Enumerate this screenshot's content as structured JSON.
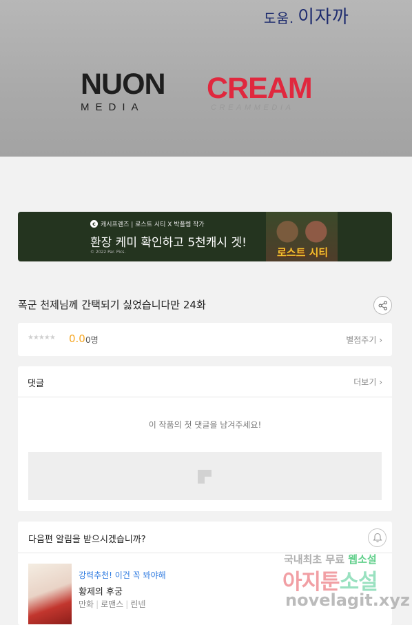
{
  "hero": {
    "credit_prefix": "도움.",
    "credit_name": "이자까",
    "logo_left_mark": "NUON",
    "logo_left_sub": "MEDIA",
    "logo_right_mark": "CREAM",
    "logo_right_sub": "CREAMMEDIA"
  },
  "ad": {
    "brand": "캐시프렌즈 | 로스트 시티 X 박플렘 작가",
    "headline": "환장 케미 확인하고 5천캐시 겟!",
    "copyright": "© 2022 Par. Pics.",
    "logo": "로스트 시티"
  },
  "episode": {
    "title": "폭군 천제님께 간택되기 싫었습니다만 24화"
  },
  "rating": {
    "score": "0.0",
    "count": "0명",
    "rate_link": "별점주기 ›",
    "stars_filled": 0,
    "stars_total": 5
  },
  "comments": {
    "title": "댓글",
    "more": "더보기 ›",
    "empty_message": "이 작품의 첫 댓글을 남겨주세요!"
  },
  "next": {
    "question": "다음편 알림을 받으시겠습니까?",
    "recommend_tag": "강력추천! 이건 꼭 봐야해",
    "recommend_title": "황제의 후궁",
    "genre_1": "만화",
    "genre_2": "로맨스",
    "genre_3": "린넨"
  },
  "watermark": {
    "line1_a": "국내최초 무료",
    "line1_b": "웹소설",
    "line2_a": "아지툰",
    "line2_b": "소설",
    "line3": "novelagit.xyz"
  },
  "colors": {
    "accent_score": "#f5a623",
    "link_blue": "#2f7be0",
    "ad_background": "#24341f",
    "cream_red": "#e0283e"
  }
}
